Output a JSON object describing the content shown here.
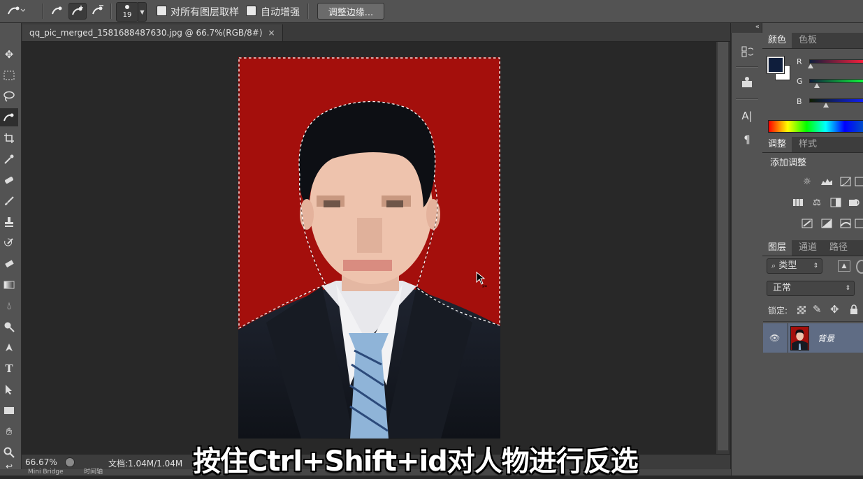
{
  "options_bar": {
    "brush_size": "19",
    "sample_all_layers_label": "对所有图层取样",
    "auto_enhance_label": "自动增强",
    "refine_edge_button": "调整边缘..."
  },
  "document": {
    "tab_title": "qq_pic_merged_1581688487630.jpg @ 66.7%(RGB/8#)",
    "close_glyph": "×"
  },
  "status": {
    "zoom": "66.67%",
    "doc_info": "文档:1.04M/1.04M"
  },
  "bottom_tabs": [
    "Mini Bridge",
    "时间轴"
  ],
  "subtitle": "按住Ctrl+Shift+id对人物进行反选",
  "panels": {
    "color_tabs": [
      "颜色",
      "色板"
    ],
    "channels": [
      "R",
      "G",
      "B"
    ],
    "foreground_color": "#0f1e3c",
    "background_color": "#ffffff",
    "adjust_tabs": [
      "调整",
      "样式"
    ],
    "add_adjustment": "添加调整",
    "layers_tabs": [
      "图层",
      "通道",
      "路径"
    ],
    "filter_type": "类型",
    "blend_mode": "正常",
    "lock_label": "锁定:",
    "layer_name": "背景"
  },
  "colors": {
    "photo_background": "#a40f0c",
    "layer_selected": "#5f6c84"
  }
}
